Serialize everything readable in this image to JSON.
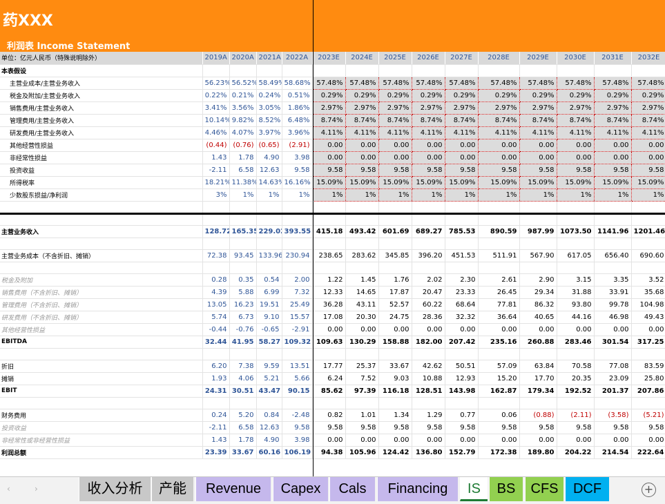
{
  "banner": {
    "company": "药XXX",
    "title": "利润表 Income Statement",
    "bg": "#ff8b10"
  },
  "header": {
    "unit_label": "单位：亿元人民币（特殊说明除外）",
    "years": [
      "2019A",
      "2020A",
      "2021A",
      "2022A",
      "2023E",
      "2024E",
      "2025E",
      "2026E",
      "2027E",
      "2028E",
      "2029E",
      "2030E",
      "2031E",
      "2032E"
    ]
  },
  "rows": [
    {
      "label": "本表假设",
      "style": "sect",
      "values": [
        "",
        "",
        "",
        "",
        "",
        "",
        "",
        "",
        "",
        "",
        "",
        "",
        "",
        ""
      ]
    },
    {
      "label": "主营业成本/主营业务收入",
      "style": "sub",
      "values": [
        "56.23%",
        "56.52%",
        "58.49%",
        "58.68%",
        "57.48%",
        "57.48%",
        "57.48%",
        "57.48%",
        "57.48%",
        "57.48%",
        "57.48%",
        "57.48%",
        "57.48%",
        "57.48%"
      ]
    },
    {
      "label": "税金及附加/主营业务收入",
      "style": "sub",
      "values": [
        "0.22%",
        "0.21%",
        "0.24%",
        "0.51%",
        "0.29%",
        "0.29%",
        "0.29%",
        "0.29%",
        "0.29%",
        "0.29%",
        "0.29%",
        "0.29%",
        "0.29%",
        "0.29%"
      ]
    },
    {
      "label": "销售费用/主营业务收入",
      "style": "sub",
      "values": [
        "3.41%",
        "3.56%",
        "3.05%",
        "1.86%",
        "2.97%",
        "2.97%",
        "2.97%",
        "2.97%",
        "2.97%",
        "2.97%",
        "2.97%",
        "2.97%",
        "2.97%",
        "2.97%"
      ]
    },
    {
      "label": "管理费用/主营业务收入",
      "style": "sub",
      "values": [
        "10.14%",
        "9.82%",
        "8.52%",
        "6.48%",
        "8.74%",
        "8.74%",
        "8.74%",
        "8.74%",
        "8.74%",
        "8.74%",
        "8.74%",
        "8.74%",
        "8.74%",
        "8.74%"
      ]
    },
    {
      "label": "研发费用/主营业务收入",
      "style": "sub",
      "values": [
        "4.46%",
        "4.07%",
        "3.97%",
        "3.96%",
        "4.11%",
        "4.11%",
        "4.11%",
        "4.11%",
        "4.11%",
        "4.11%",
        "4.11%",
        "4.11%",
        "4.11%",
        "4.11%"
      ]
    },
    {
      "label": "其他经营性损益",
      "style": "sub",
      "values": [
        "(0.44)",
        "(0.76)",
        "(0.65)",
        "(2.91)",
        "0.00",
        "0.00",
        "0.00",
        "0.00",
        "0.00",
        "0.00",
        "0.00",
        "0.00",
        "0.00",
        "0.00"
      ]
    },
    {
      "label": "非经常性损益",
      "style": "sub",
      "values": [
        "1.43",
        "1.78",
        "4.90",
        "3.98",
        "0.00",
        "0.00",
        "0.00",
        "0.00",
        "0.00",
        "0.00",
        "0.00",
        "0.00",
        "0.00",
        "0.00"
      ]
    },
    {
      "label": "投资收益",
      "style": "sub",
      "values": [
        "-2.11",
        "6.58",
        "12.63",
        "9.58",
        "9.58",
        "9.58",
        "9.58",
        "9.58",
        "9.58",
        "9.58",
        "9.58",
        "9.58",
        "9.58",
        "9.58"
      ]
    },
    {
      "label": "所得税率",
      "style": "sub",
      "values": [
        "18.21%",
        "11.38%",
        "14.63%",
        "16.16%",
        "15.09%",
        "15.09%",
        "15.09%",
        "15.09%",
        "15.09%",
        "15.09%",
        "15.09%",
        "15.09%",
        "15.09%",
        "15.09%"
      ]
    },
    {
      "label": "少数股东损益/净利润",
      "style": "sub",
      "values": [
        "3%",
        "1%",
        "1%",
        "1%",
        "1%",
        "1%",
        "1%",
        "1%",
        "1%",
        "1%",
        "1%",
        "1%",
        "1%",
        "1%"
      ]
    },
    {
      "label": "",
      "style": "thick",
      "values": [
        "",
        "",
        "",
        "",
        "",
        "",
        "",
        "",
        "",
        "",
        "",
        "",
        "",
        ""
      ]
    },
    {
      "label": "",
      "style": "blank",
      "values": [
        "",
        "",
        "",
        "",
        "",
        "",
        "",
        "",
        "",
        "",
        "",
        "",
        "",
        ""
      ]
    },
    {
      "label": "主营业务收入",
      "style": "bold",
      "values": [
        "128.72",
        "165.35",
        "229.02",
        "393.55",
        "415.18",
        "493.42",
        "601.69",
        "689.27",
        "785.53",
        "890.59",
        "987.99",
        "1073.50",
        "1141.96",
        "1201.46"
      ]
    },
    {
      "label": "",
      "style": "blank",
      "values": [
        "",
        "",
        "",
        "",
        "",
        "",
        "",
        "",
        "",
        "",
        "",
        "",
        "",
        ""
      ]
    },
    {
      "label": "主营业务成本（不含折旧、摊销）",
      "style": "normal",
      "values": [
        "72.38",
        "93.45",
        "133.96",
        "230.94",
        "238.65",
        "283.62",
        "345.85",
        "396.20",
        "451.53",
        "511.91",
        "567.90",
        "617.05",
        "656.40",
        "690.60"
      ]
    },
    {
      "label": "",
      "style": "blank",
      "values": [
        "",
        "",
        "",
        "",
        "",
        "",
        "",
        "",
        "",
        "",
        "",
        "",
        "",
        ""
      ]
    },
    {
      "label": "税金及附加",
      "style": "gray",
      "values": [
        "0.28",
        "0.35",
        "0.54",
        "2.00",
        "1.22",
        "1.45",
        "1.76",
        "2.02",
        "2.30",
        "2.61",
        "2.90",
        "3.15",
        "3.35",
        "3.52"
      ]
    },
    {
      "label": "销售费用（不含折旧、摊销）",
      "style": "gray",
      "values": [
        "4.39",
        "5.88",
        "6.99",
        "7.32",
        "12.33",
        "14.65",
        "17.87",
        "20.47",
        "23.33",
        "26.45",
        "29.34",
        "31.88",
        "33.91",
        "35.68"
      ]
    },
    {
      "label": "管理费用（不含折旧、摊销）",
      "style": "gray",
      "values": [
        "13.05",
        "16.23",
        "19.51",
        "25.49",
        "36.28",
        "43.11",
        "52.57",
        "60.22",
        "68.64",
        "77.81",
        "86.32",
        "93.80",
        "99.78",
        "104.98"
      ]
    },
    {
      "label": "研发费用（不含折旧、摊销）",
      "style": "gray",
      "values": [
        "5.74",
        "6.73",
        "9.10",
        "15.57",
        "17.08",
        "20.30",
        "24.75",
        "28.36",
        "32.32",
        "36.64",
        "40.65",
        "44.16",
        "46.98",
        "49.43"
      ]
    },
    {
      "label": "其他经营性损益",
      "style": "gray",
      "values": [
        "-0.44",
        "-0.76",
        "-0.65",
        "-2.91",
        "0.00",
        "0.00",
        "0.00",
        "0.00",
        "0.00",
        "0.00",
        "0.00",
        "0.00",
        "0.00",
        "0.00"
      ]
    },
    {
      "label": "EBITDA",
      "style": "bold",
      "values": [
        "32.44",
        "41.95",
        "58.27",
        "109.32",
        "109.63",
        "130.29",
        "158.88",
        "182.00",
        "207.42",
        "235.16",
        "260.88",
        "283.46",
        "301.54",
        "317.25"
      ]
    },
    {
      "label": "",
      "style": "blank",
      "values": [
        "",
        "",
        "",
        "",
        "",
        "",
        "",
        "",
        "",
        "",
        "",
        "",
        "",
        ""
      ]
    },
    {
      "label": "折旧",
      "style": "normal",
      "values": [
        "6.20",
        "7.38",
        "9.59",
        "13.51",
        "17.77",
        "25.37",
        "33.67",
        "42.62",
        "50.51",
        "57.09",
        "63.84",
        "70.58",
        "77.08",
        "83.59"
      ]
    },
    {
      "label": "摊销",
      "style": "normal",
      "values": [
        "1.93",
        "4.06",
        "5.21",
        "5.66",
        "6.24",
        "7.52",
        "9.03",
        "10.88",
        "12.93",
        "15.20",
        "17.70",
        "20.35",
        "23.09",
        "25.80"
      ]
    },
    {
      "label": "EBIT",
      "style": "bold",
      "values": [
        "24.31",
        "30.51",
        "43.47",
        "90.15",
        "85.62",
        "97.39",
        "116.18",
        "128.51",
        "143.98",
        "162.87",
        "179.34",
        "192.52",
        "201.37",
        "207.86"
      ]
    },
    {
      "label": "",
      "style": "blank",
      "values": [
        "",
        "",
        "",
        "",
        "",
        "",
        "",
        "",
        "",
        "",
        "",
        "",
        "",
        ""
      ]
    },
    {
      "label": "财务费用",
      "style": "normal",
      "values": [
        "0.24",
        "5.20",
        "0.84",
        "-2.48",
        "0.82",
        "1.01",
        "1.34",
        "1.29",
        "0.77",
        "0.06",
        "(0.88)",
        "(2.11)",
        "(3.58)",
        "(5.21)"
      ]
    },
    {
      "label": "投资收益",
      "style": "gray",
      "values": [
        "-2.11",
        "6.58",
        "12.63",
        "9.58",
        "9.58",
        "9.58",
        "9.58",
        "9.58",
        "9.58",
        "9.58",
        "9.58",
        "9.58",
        "9.58",
        "9.58"
      ]
    },
    {
      "label": "非经常性或非经营性损益",
      "style": "gray",
      "values": [
        "1.43",
        "1.78",
        "4.90",
        "3.98",
        "0.00",
        "0.00",
        "0.00",
        "0.00",
        "0.00",
        "0.00",
        "0.00",
        "0.00",
        "0.00",
        "0.00"
      ]
    },
    {
      "label": "利润总额",
      "style": "bold",
      "values": [
        "23.39",
        "33.67",
        "60.16",
        "106.19",
        "94.38",
        "105.96",
        "124.42",
        "136.80",
        "152.79",
        "172.38",
        "189.80",
        "204.22",
        "214.54",
        "222.64"
      ]
    }
  ],
  "tabs": [
    {
      "label": "收入分析",
      "bg": "#c8c8c8",
      "active": false
    },
    {
      "label": "产能",
      "bg": "#c8c8c8",
      "active": false
    },
    {
      "label": "Revenue",
      "bg": "#c5b8ec",
      "active": false
    },
    {
      "label": "Capex",
      "bg": "#c5b8ec",
      "active": false
    },
    {
      "label": "Cals",
      "bg": "#c5b8ec",
      "active": false
    },
    {
      "label": "Financing",
      "bg": "#c5b8ec",
      "active": false
    },
    {
      "label": "IS",
      "bg": "#ffffff",
      "active": true
    },
    {
      "label": "BS",
      "bg": "#92d050",
      "active": false
    },
    {
      "label": "CFS",
      "bg": "#92d050",
      "active": false
    },
    {
      "label": "DCF",
      "bg": "#00b0f0",
      "active": false
    }
  ],
  "tabbar": {
    "prev_icon": "‹",
    "next_icon": "›",
    "add_icon": "+"
  },
  "colors": {
    "historical_blue": "#2f5597",
    "negative_red": "#c00000",
    "forecast_fill": "#dcdcdc",
    "active_tab_green": "#1e7b34"
  }
}
